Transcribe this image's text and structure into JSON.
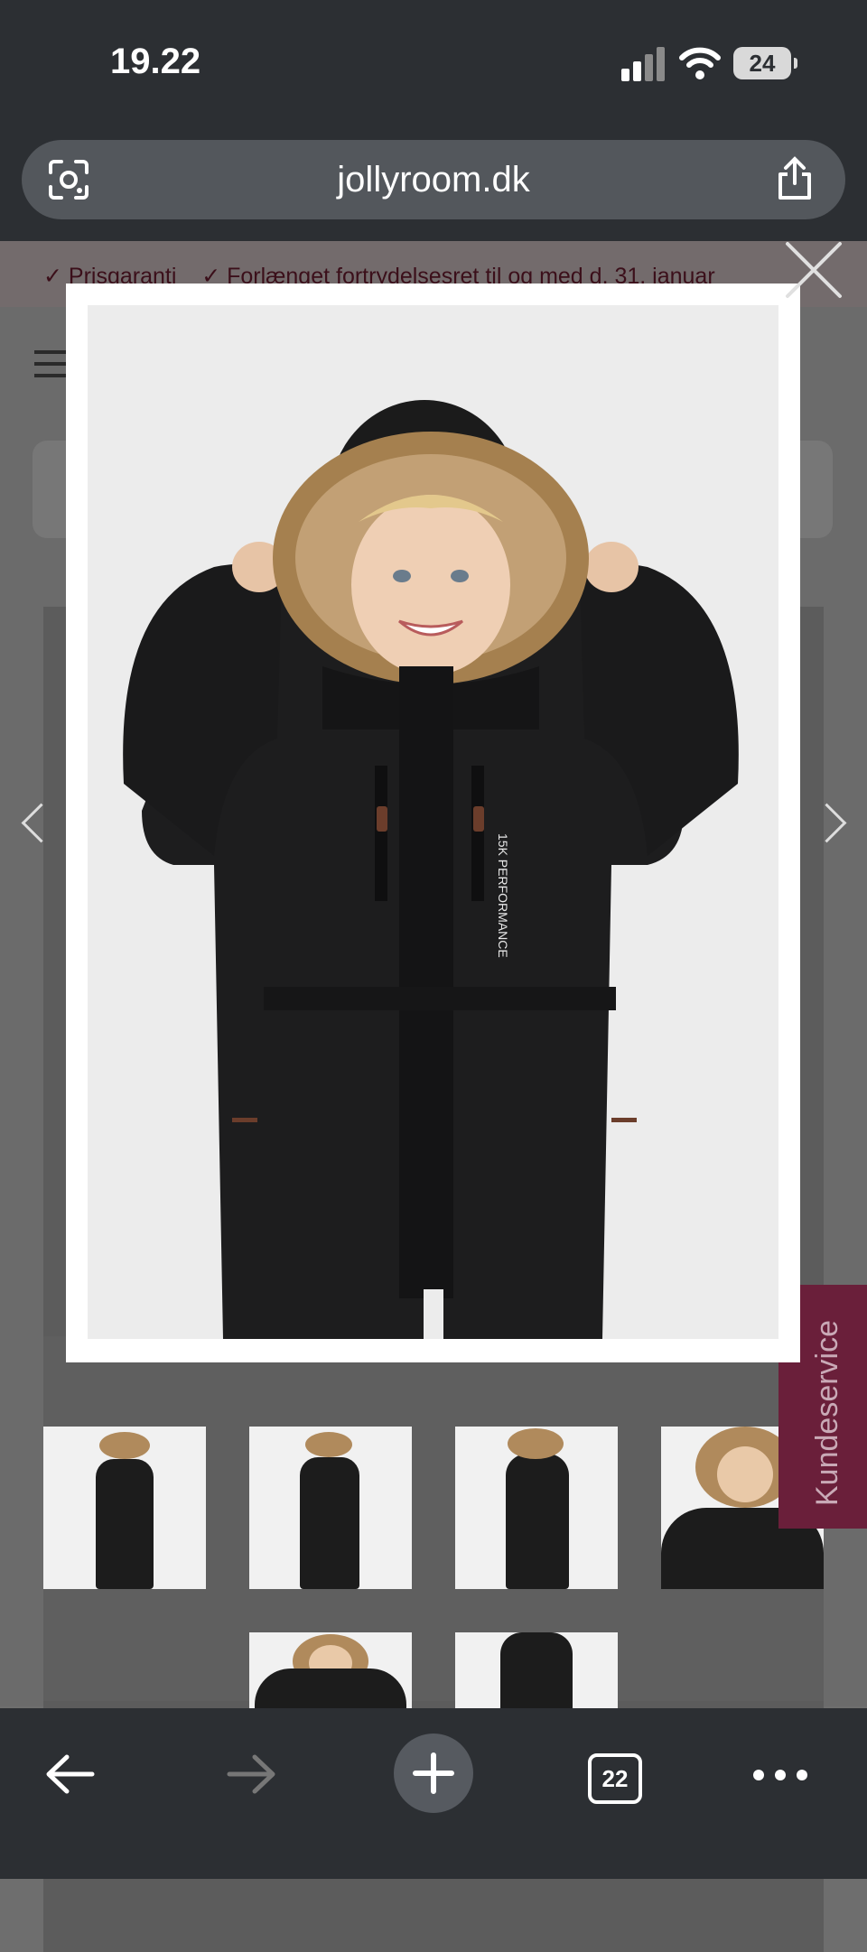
{
  "status_bar": {
    "time": "19.22",
    "battery": "24"
  },
  "browser": {
    "url": "jollyroom.dk",
    "tab_count": "22"
  },
  "banner": {
    "items": [
      "Prisgaranti",
      "Forlænget fortrydelsesret til og med d. 31. januar"
    ]
  },
  "product_image": {
    "brand_text": "15K PERFORMANCE"
  },
  "customer_service": {
    "label": "Kundeservice"
  },
  "icons": {
    "lens": "google-lens-icon",
    "share": "share-icon",
    "close": "close-icon",
    "back": "back-arrow-icon",
    "forward": "forward-arrow-icon",
    "new_tab": "plus-icon",
    "more": "more-dots-icon"
  },
  "colors": {
    "banner_text": "#3b0f1a",
    "accent": "#6a1f3a",
    "toolbar": "#2c2f33"
  }
}
